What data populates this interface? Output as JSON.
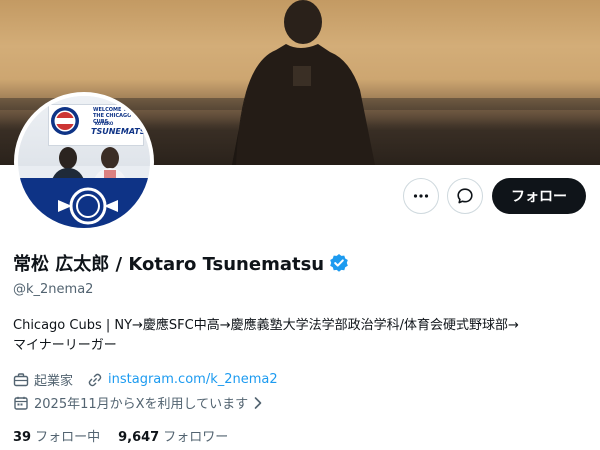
{
  "profile": {
    "display_name": "常松 広太郎 / Kotaro Tsunematsu",
    "handle": "@k_2nema2",
    "bio_lines": [
      "Chicago Cubs | NY→慶應SFC中高→慶應義塾大学法学部政治学科/体育会硬式野球部→",
      "マイナーリーガー"
    ],
    "occupation": "起業家",
    "website": "instagram.com/k_2nema2",
    "joined": "2025年11月からXを利用しています",
    "following_count": "39",
    "following_label": "フォロー中",
    "followers_count": "9,647",
    "followers_label": "フォロワー"
  },
  "actions": {
    "follow_label": "フォロー"
  },
  "avatar": {
    "sign_title": "WELCOME TO THE CHICAGO CUBS",
    "sign_sub": "KOTARO",
    "sign_name": "TSUNEMATSU",
    "logo_text": "CUBS"
  },
  "icons": {
    "more": "more-icon",
    "message": "message-icon",
    "verified": "verified-badge-icon",
    "occupation": "briefcase-icon",
    "link": "link-icon",
    "calendar": "calendar-icon",
    "chevron": "chevron-right-icon"
  },
  "colors": {
    "accent": "#1d9bf0",
    "text": "#0f1419",
    "muted": "#536471",
    "follow_button_bg": "#0f1419",
    "cubs_blue": "#0e3386",
    "cubs_red": "#cc3433"
  }
}
